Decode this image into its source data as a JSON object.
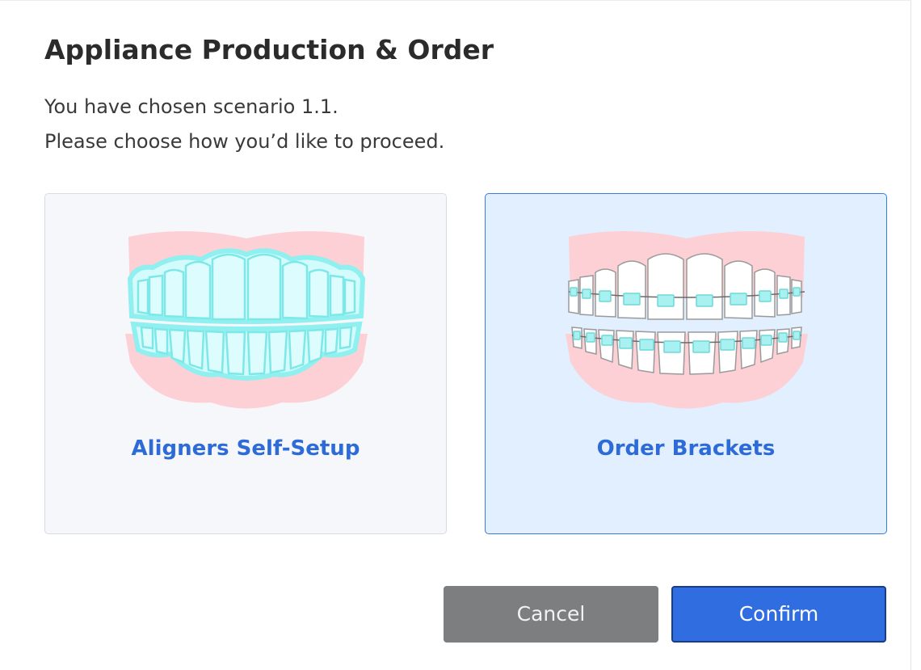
{
  "dialog": {
    "title": "Appliance Production & Order",
    "description_line1": "You have chosen scenario 1.1.",
    "description_line2": "Please choose how you’d like to proceed."
  },
  "options": [
    {
      "label": "Aligners Self-Setup",
      "icon": "aligners-teeth-illustration",
      "selected": false
    },
    {
      "label": "Order Brackets",
      "icon": "brackets-teeth-illustration",
      "selected": true
    }
  ],
  "buttons": {
    "cancel_label": "Cancel",
    "confirm_label": "Confirm"
  },
  "colors": {
    "accent": "#2f6de0",
    "selected_card_bg": "#e1efff",
    "card_bg": "#f6f7fb",
    "cancel_bg": "#7d7e80",
    "gum_pink": "#fdd0d6",
    "aligner_cyan": "#8ff0ef"
  }
}
